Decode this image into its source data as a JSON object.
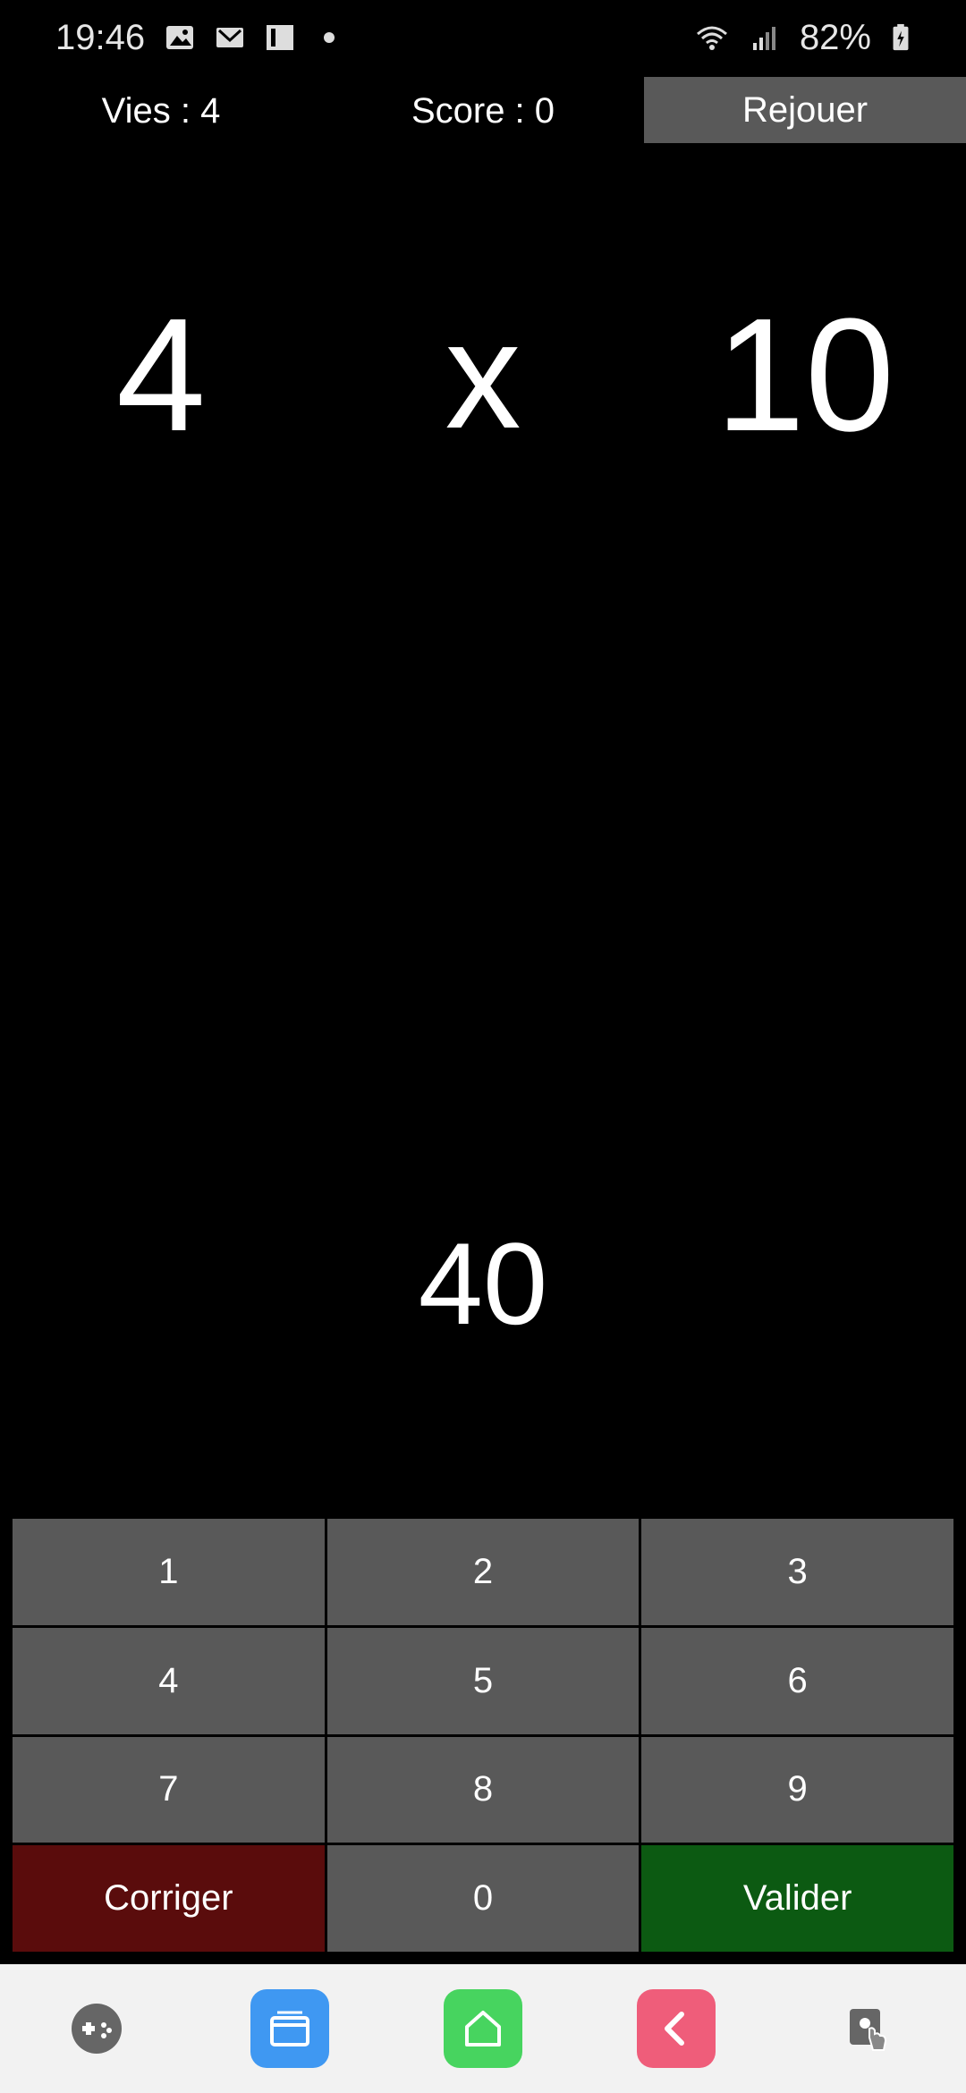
{
  "status_bar": {
    "time": "19:46",
    "battery": "82%",
    "icons": [
      "image-icon",
      "mail-icon",
      "app-icon",
      "wifi-icon",
      "signal-icon",
      "battery-icon"
    ]
  },
  "game": {
    "lives_label": "Vies : 4",
    "score_label": "Score : 0",
    "replay_label": "Rejouer",
    "operand1": "4",
    "operator": "x",
    "operand2": "10",
    "answer": "40"
  },
  "keypad": {
    "k1": "1",
    "k2": "2",
    "k3": "3",
    "k4": "4",
    "k5": "5",
    "k6": "6",
    "k7": "7",
    "k8": "8",
    "k9": "9",
    "correct": "Corriger",
    "k0": "0",
    "validate": "Valider"
  },
  "colors": {
    "background": "#000000",
    "key": "#595959",
    "correct_key": "#5a0c0c",
    "validate_key": "#0c5a12"
  },
  "bottom_nav": {
    "icons": [
      "gamepad-icon",
      "window-icon",
      "home-icon",
      "back-icon",
      "lock-hand-icon"
    ]
  }
}
